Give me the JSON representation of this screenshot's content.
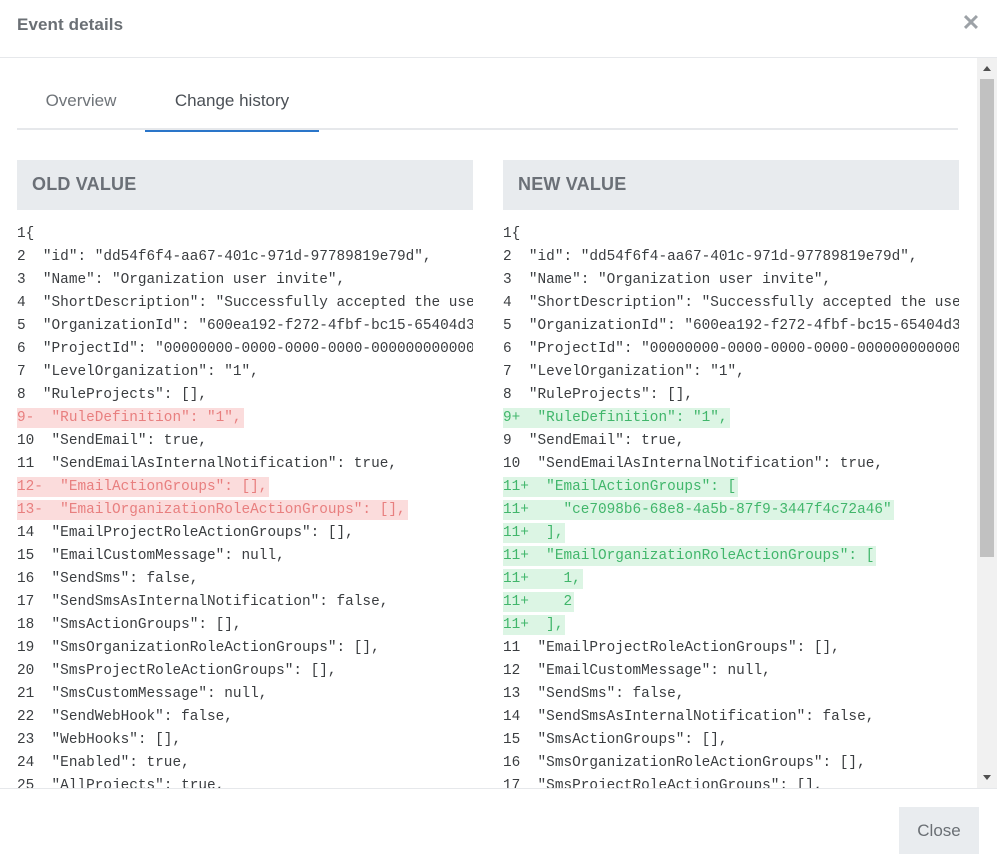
{
  "modal": {
    "title": "Event details",
    "close_icon": "close-icon",
    "close_glyph": "✕"
  },
  "tabs": [
    {
      "label": "Overview",
      "active": false
    },
    {
      "label": "Change history",
      "active": true
    }
  ],
  "old_panel": {
    "title": "OLD VALUE",
    "lines": [
      {
        "text": "1{",
        "type": "normal"
      },
      {
        "text": "2  \"id\": \"dd54f6f4-aa67-401c-971d-97789819e79d\",",
        "type": "normal"
      },
      {
        "text": "3  \"Name\": \"Organization user invite\",",
        "type": "normal"
      },
      {
        "text": "4  \"ShortDescription\": \"Successfully accepted the use",
        "type": "normal"
      },
      {
        "text": "5  \"OrganizationId\": \"600ea192-f272-4fbf-bc15-65404d3",
        "type": "normal"
      },
      {
        "text": "6  \"ProjectId\": \"00000000-0000-0000-0000-000000000000",
        "type": "normal"
      },
      {
        "text": "7  \"LevelOrganization\": \"1\",",
        "type": "normal"
      },
      {
        "text": "8  \"RuleProjects\": [],",
        "type": "normal"
      },
      {
        "text": "9-  \"RuleDefinition\": \"1\",",
        "type": "del"
      },
      {
        "text": "10  \"SendEmail\": true,",
        "type": "normal"
      },
      {
        "text": "11  \"SendEmailAsInternalNotification\": true,",
        "type": "normal"
      },
      {
        "text": "12-  \"EmailActionGroups\": [],",
        "type": "del"
      },
      {
        "text": "13-  \"EmailOrganizationRoleActionGroups\": [],",
        "type": "del"
      },
      {
        "text": "14  \"EmailProjectRoleActionGroups\": [],",
        "type": "normal"
      },
      {
        "text": "15  \"EmailCustomMessage\": null,",
        "type": "normal"
      },
      {
        "text": "16  \"SendSms\": false,",
        "type": "normal"
      },
      {
        "text": "17  \"SendSmsAsInternalNotification\": false,",
        "type": "normal"
      },
      {
        "text": "18  \"SmsActionGroups\": [],",
        "type": "normal"
      },
      {
        "text": "19  \"SmsOrganizationRoleActionGroups\": [],",
        "type": "normal"
      },
      {
        "text": "20  \"SmsProjectRoleActionGroups\": [],",
        "type": "normal"
      },
      {
        "text": "21  \"SmsCustomMessage\": null,",
        "type": "normal"
      },
      {
        "text": "22  \"SendWebHook\": false,",
        "type": "normal"
      },
      {
        "text": "23  \"WebHooks\": [],",
        "type": "normal"
      },
      {
        "text": "24  \"Enabled\": true,",
        "type": "normal"
      },
      {
        "text": "25  \"AllProjects\": true,",
        "type": "normal"
      }
    ]
  },
  "new_panel": {
    "title": "NEW VALUE",
    "lines": [
      {
        "text": "1{",
        "type": "normal"
      },
      {
        "text": "2  \"id\": \"dd54f6f4-aa67-401c-971d-97789819e79d\",",
        "type": "normal"
      },
      {
        "text": "3  \"Name\": \"Organization user invite\",",
        "type": "normal"
      },
      {
        "text": "4  \"ShortDescription\": \"Successfully accepted the use",
        "type": "normal"
      },
      {
        "text": "5  \"OrganizationId\": \"600ea192-f272-4fbf-bc15-65404d3",
        "type": "normal"
      },
      {
        "text": "6  \"ProjectId\": \"00000000-0000-0000-0000-000000000000",
        "type": "normal"
      },
      {
        "text": "7  \"LevelOrganization\": \"1\",",
        "type": "normal"
      },
      {
        "text": "8  \"RuleProjects\": [],",
        "type": "normal"
      },
      {
        "text": "9+  \"RuleDefinition\": \"1\",",
        "type": "add"
      },
      {
        "text": "9  \"SendEmail\": true,",
        "type": "normal"
      },
      {
        "text": "10  \"SendEmailAsInternalNotification\": true,",
        "type": "normal"
      },
      {
        "text": "11+  \"EmailActionGroups\": [",
        "type": "add"
      },
      {
        "text": "11+    \"ce7098b6-68e8-4a5b-87f9-3447f4c72a46\"",
        "type": "add"
      },
      {
        "text": "11+  ],",
        "type": "add"
      },
      {
        "text": "11+  \"EmailOrganizationRoleActionGroups\": [",
        "type": "add"
      },
      {
        "text": "11+    1,",
        "type": "add"
      },
      {
        "text": "11+    2",
        "type": "add"
      },
      {
        "text": "11+  ],",
        "type": "add"
      },
      {
        "text": "11  \"EmailProjectRoleActionGroups\": [],",
        "type": "normal"
      },
      {
        "text": "12  \"EmailCustomMessage\": null,",
        "type": "normal"
      },
      {
        "text": "13  \"SendSms\": false,",
        "type": "normal"
      },
      {
        "text": "14  \"SendSmsAsInternalNotification\": false,",
        "type": "normal"
      },
      {
        "text": "15  \"SmsActionGroups\": [],",
        "type": "normal"
      },
      {
        "text": "16  \"SmsOrganizationRoleActionGroups\": [],",
        "type": "normal"
      },
      {
        "text": "17  \"SmsProjectRoleActionGroups\": [],",
        "type": "normal"
      }
    ]
  },
  "footer": {
    "close_label": "Close"
  },
  "colors": {
    "accent": "#2a75c9",
    "deleted_bg": "#fbdcdc",
    "deleted_text": "#e87f7f",
    "added_bg": "#dcf5e4",
    "added_text": "#41b66b",
    "panel_header_bg": "#e8ebee"
  }
}
